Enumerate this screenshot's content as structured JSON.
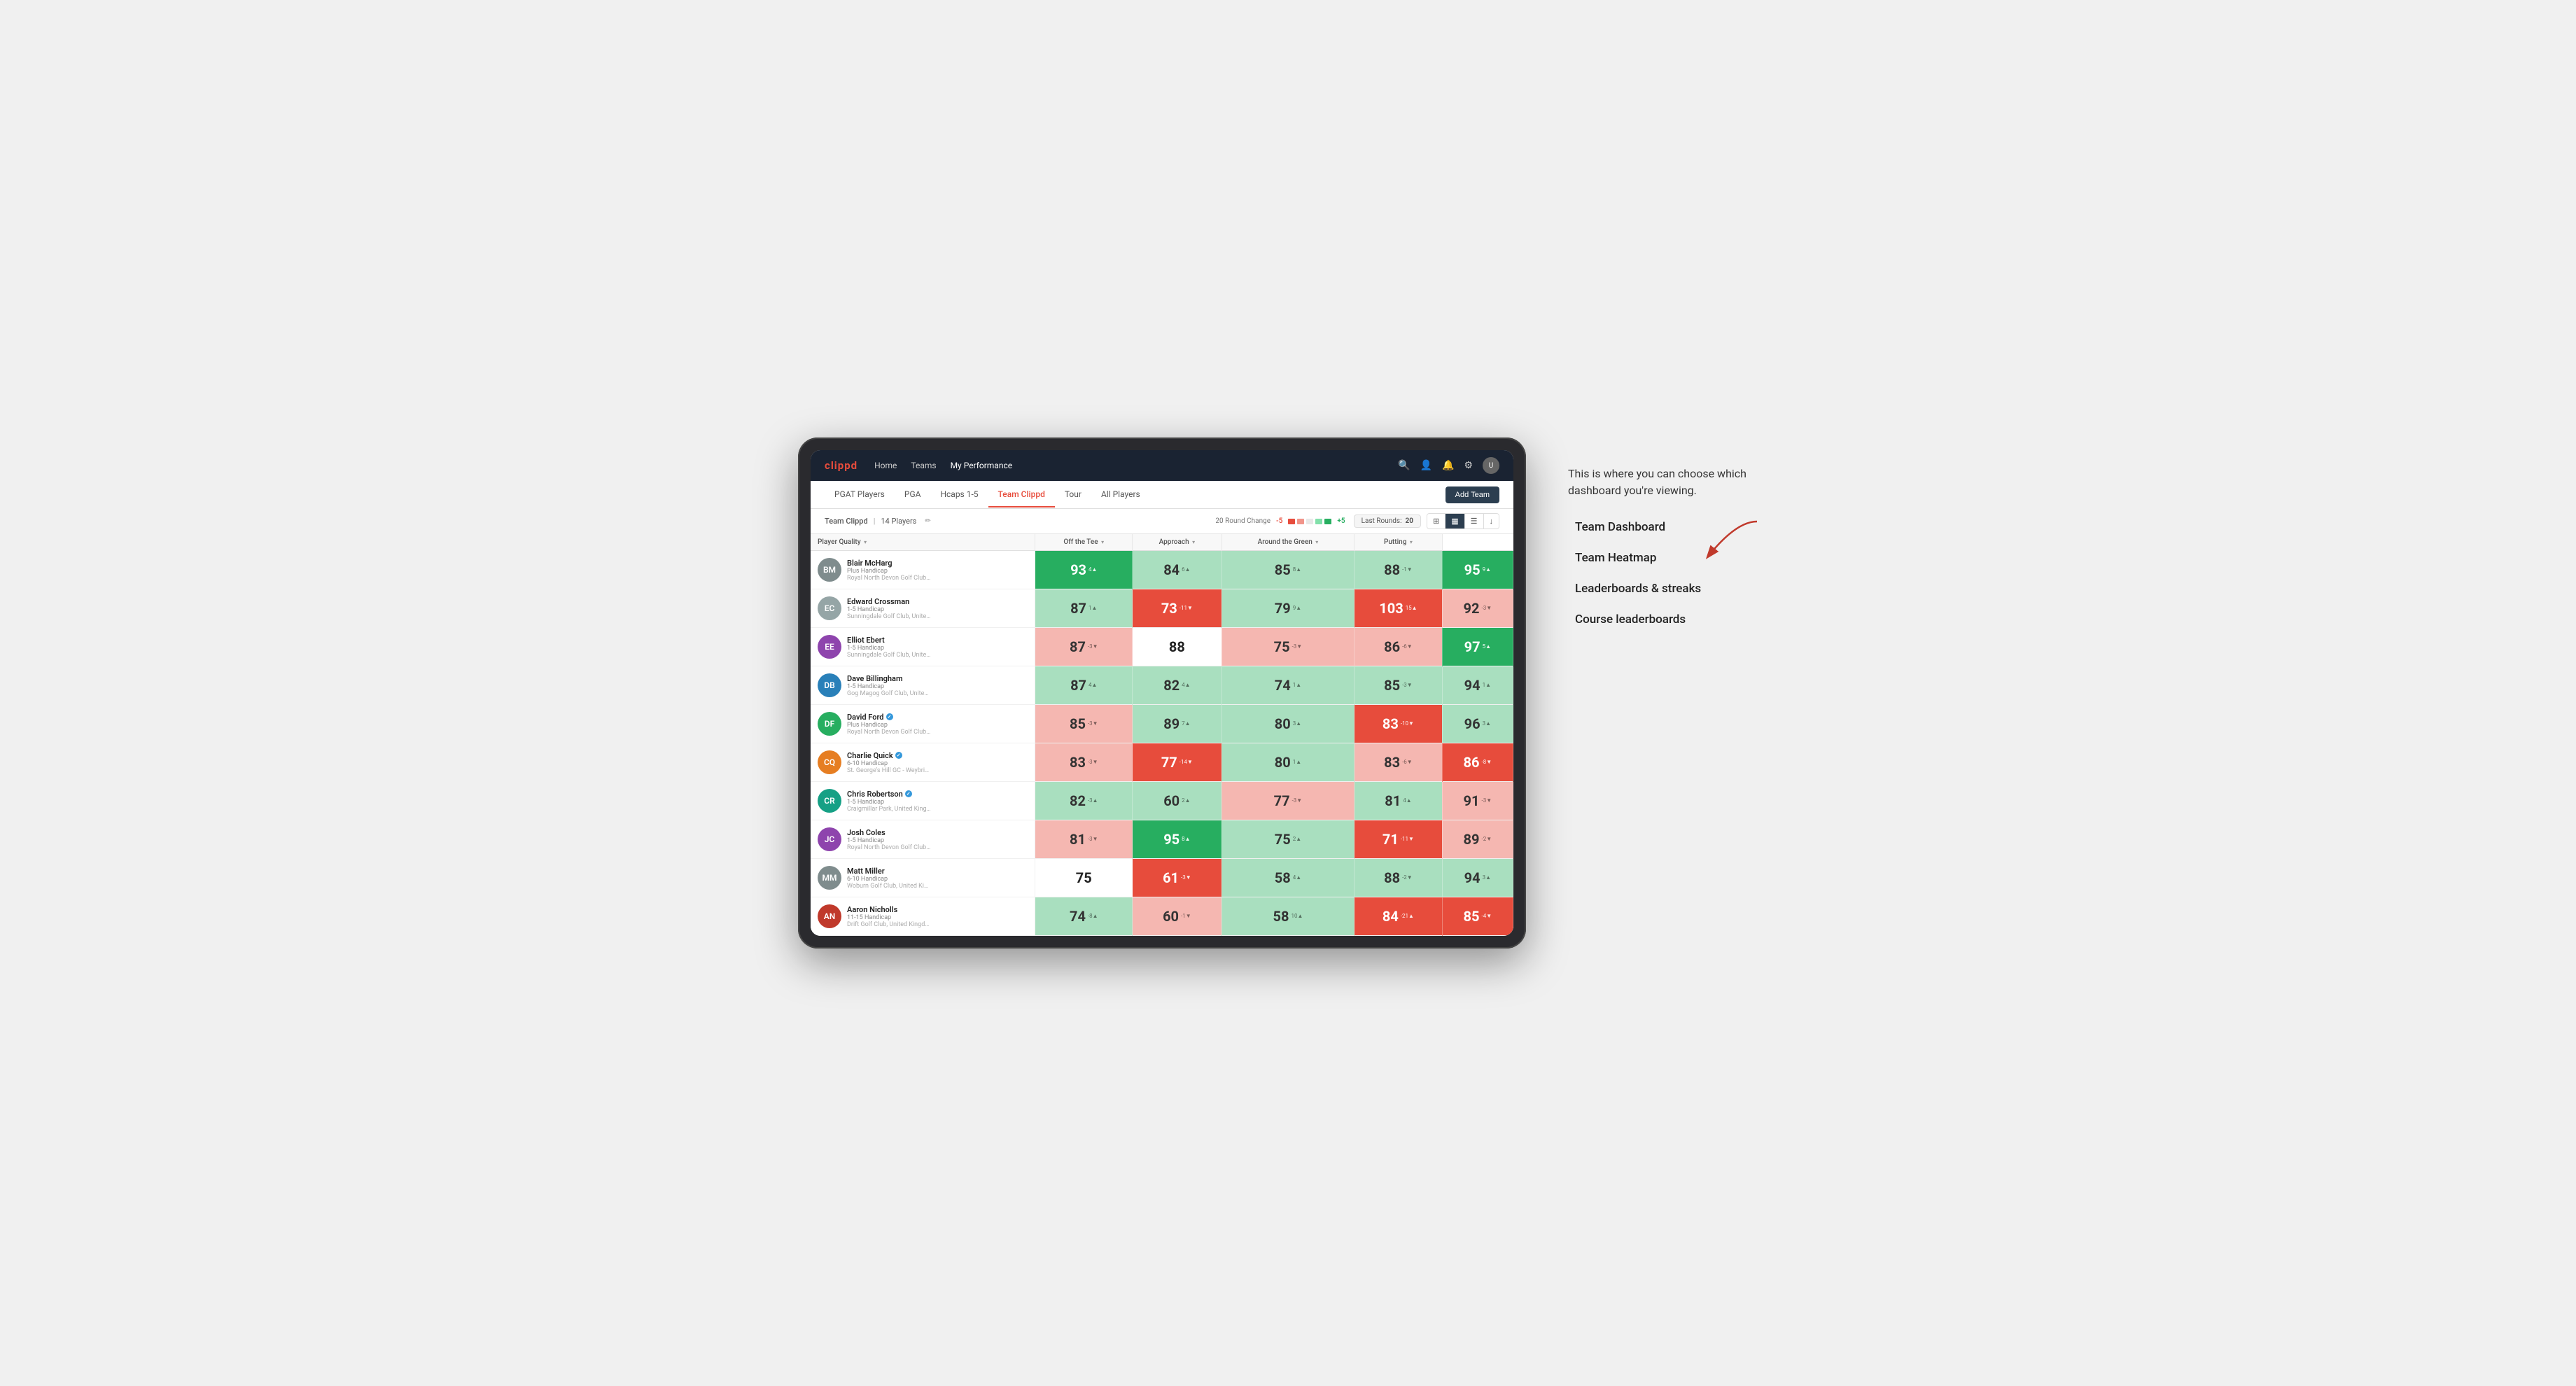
{
  "annotation": {
    "description": "This is where you can choose which dashboard you're viewing.",
    "items": [
      "Team Dashboard",
      "Team Heatmap",
      "Leaderboards & streaks",
      "Course leaderboards"
    ]
  },
  "nav": {
    "logo": "clippd",
    "links": [
      {
        "label": "Home",
        "active": false
      },
      {
        "label": "Teams",
        "active": false
      },
      {
        "label": "My Performance",
        "active": true
      }
    ],
    "icons": [
      "search",
      "person",
      "notifications",
      "settings",
      "avatar"
    ]
  },
  "sub_nav": {
    "links": [
      {
        "label": "PGAT Players",
        "active": false
      },
      {
        "label": "PGA",
        "active": false
      },
      {
        "label": "Hcaps 1-5",
        "active": false
      },
      {
        "label": "Team Clippd",
        "active": true
      },
      {
        "label": "Tour",
        "active": false
      },
      {
        "label": "All Players",
        "active": false
      }
    ],
    "add_team_label": "Add Team"
  },
  "toolbar": {
    "team_label": "Team Clippd",
    "player_count": "14 Players",
    "round_change_label": "20 Round Change",
    "minus_label": "-5",
    "plus_label": "+5",
    "last_rounds_label": "Last Rounds:",
    "last_rounds_value": "20",
    "view_buttons": [
      "grid",
      "heatmap",
      "list",
      "download"
    ]
  },
  "table": {
    "headers": [
      {
        "label": "Player Quality",
        "sortable": true
      },
      {
        "label": "Off the Tee",
        "sortable": true
      },
      {
        "label": "Approach",
        "sortable": true
      },
      {
        "label": "Around the Green",
        "sortable": true
      },
      {
        "label": "Putting",
        "sortable": true
      }
    ],
    "players": [
      {
        "name": "Blair McHarg",
        "handicap": "Plus Handicap",
        "club": "Royal North Devon Golf Club, United Kingdom",
        "initials": "BM",
        "color": "#7f8c8d",
        "scores": [
          {
            "value": 93,
            "change": "4▲",
            "bg": "green-dark"
          },
          {
            "value": 84,
            "change": "6▲",
            "bg": "green-light"
          },
          {
            "value": 85,
            "change": "8▲",
            "bg": "green-light"
          },
          {
            "value": 88,
            "change": "-1▼",
            "bg": "green-light"
          },
          {
            "value": 95,
            "change": "9▲",
            "bg": "green-dark"
          }
        ]
      },
      {
        "name": "Edward Crossman",
        "handicap": "1-5 Handicap",
        "club": "Sunningdale Golf Club, United Kingdom",
        "initials": "EC",
        "color": "#95a5a6",
        "scores": [
          {
            "value": 87,
            "change": "1▲",
            "bg": "green-light"
          },
          {
            "value": 73,
            "change": "-11▼",
            "bg": "red-dark"
          },
          {
            "value": 79,
            "change": "9▲",
            "bg": "green-light"
          },
          {
            "value": 103,
            "change": "15▲",
            "bg": "red-dark"
          },
          {
            "value": 92,
            "change": "-3▼",
            "bg": "red-light"
          }
        ]
      },
      {
        "name": "Elliot Ebert",
        "handicap": "1-5 Handicap",
        "club": "Sunningdale Golf Club, United Kingdom",
        "initials": "EE",
        "color": "#8e44ad",
        "scores": [
          {
            "value": 87,
            "change": "-3▼",
            "bg": "red-light"
          },
          {
            "value": 88,
            "change": "",
            "bg": "white"
          },
          {
            "value": 75,
            "change": "-3▼",
            "bg": "red-light"
          },
          {
            "value": 86,
            "change": "-6▼",
            "bg": "red-light"
          },
          {
            "value": 97,
            "change": "5▲",
            "bg": "green-dark"
          }
        ]
      },
      {
        "name": "Dave Billingham",
        "handicap": "1-5 Handicap",
        "club": "Gog Magog Golf Club, United Kingdom",
        "initials": "DB",
        "color": "#2980b9",
        "scores": [
          {
            "value": 87,
            "change": "4▲",
            "bg": "green-light"
          },
          {
            "value": 82,
            "change": "4▲",
            "bg": "green-light"
          },
          {
            "value": 74,
            "change": "1▲",
            "bg": "green-light"
          },
          {
            "value": 85,
            "change": "-3▼",
            "bg": "green-light"
          },
          {
            "value": 94,
            "change": "1▲",
            "bg": "green-light"
          }
        ]
      },
      {
        "name": "David Ford",
        "handicap": "Plus Handicap",
        "club": "Royal North Devon Golf Club, United Kingdom",
        "initials": "DF",
        "color": "#27ae60",
        "verified": true,
        "scores": [
          {
            "value": 85,
            "change": "-3▼",
            "bg": "red-light"
          },
          {
            "value": 89,
            "change": "7▲",
            "bg": "green-light"
          },
          {
            "value": 80,
            "change": "3▲",
            "bg": "green-light"
          },
          {
            "value": 83,
            "change": "-10▼",
            "bg": "red-dark"
          },
          {
            "value": 96,
            "change": "3▲",
            "bg": "green-light"
          }
        ]
      },
      {
        "name": "Charlie Quick",
        "handicap": "6-10 Handicap",
        "club": "St. George's Hill GC - Weybridge - Surrey, Uni...",
        "initials": "CQ",
        "color": "#e67e22",
        "verified": true,
        "scores": [
          {
            "value": 83,
            "change": "-3▼",
            "bg": "red-light"
          },
          {
            "value": 77,
            "change": "-14▼",
            "bg": "red-dark"
          },
          {
            "value": 80,
            "change": "1▲",
            "bg": "green-light"
          },
          {
            "value": 83,
            "change": "-6▼",
            "bg": "red-light"
          },
          {
            "value": 86,
            "change": "-8▼",
            "bg": "red-dark"
          }
        ]
      },
      {
        "name": "Chris Robertson",
        "handicap": "1-5 Handicap",
        "club": "Craigmillar Park, United Kingdom",
        "initials": "CR",
        "color": "#16a085",
        "verified": true,
        "scores": [
          {
            "value": 82,
            "change": "-3▲",
            "bg": "green-light"
          },
          {
            "value": 60,
            "change": "2▲",
            "bg": "green-light"
          },
          {
            "value": 77,
            "change": "-3▼",
            "bg": "red-light"
          },
          {
            "value": 81,
            "change": "4▲",
            "bg": "green-light"
          },
          {
            "value": 91,
            "change": "-3▼",
            "bg": "red-light"
          }
        ]
      },
      {
        "name": "Josh Coles",
        "handicap": "1-5 Handicap",
        "club": "Royal North Devon Golf Club, United Kingdom",
        "initials": "JC",
        "color": "#8e44ad",
        "scores": [
          {
            "value": 81,
            "change": "-3▼",
            "bg": "red-light"
          },
          {
            "value": 95,
            "change": "8▲",
            "bg": "green-dark"
          },
          {
            "value": 75,
            "change": "2▲",
            "bg": "green-light"
          },
          {
            "value": 71,
            "change": "-11▼",
            "bg": "red-dark"
          },
          {
            "value": 89,
            "change": "-2▼",
            "bg": "red-light"
          }
        ]
      },
      {
        "name": "Matt Miller",
        "handicap": "6-10 Handicap",
        "club": "Woburn Golf Club, United Kingdom",
        "initials": "MM",
        "color": "#7f8c8d",
        "scores": [
          {
            "value": 75,
            "change": "",
            "bg": "white"
          },
          {
            "value": 61,
            "change": "-3▼",
            "bg": "red-dark"
          },
          {
            "value": 58,
            "change": "4▲",
            "bg": "green-light"
          },
          {
            "value": 88,
            "change": "-2▼",
            "bg": "green-light"
          },
          {
            "value": 94,
            "change": "3▲",
            "bg": "green-light"
          }
        ]
      },
      {
        "name": "Aaron Nicholls",
        "handicap": "11-15 Handicap",
        "club": "Drift Golf Club, United Kingdom",
        "initials": "AN",
        "color": "#c0392b",
        "scores": [
          {
            "value": 74,
            "change": "-8▲",
            "bg": "green-light"
          },
          {
            "value": 60,
            "change": "-1▼",
            "bg": "red-light"
          },
          {
            "value": 58,
            "change": "10▲",
            "bg": "green-light"
          },
          {
            "value": 84,
            "change": "-21▲",
            "bg": "red-dark"
          },
          {
            "value": 85,
            "change": "-4▼",
            "bg": "red-dark"
          }
        ]
      }
    ]
  }
}
